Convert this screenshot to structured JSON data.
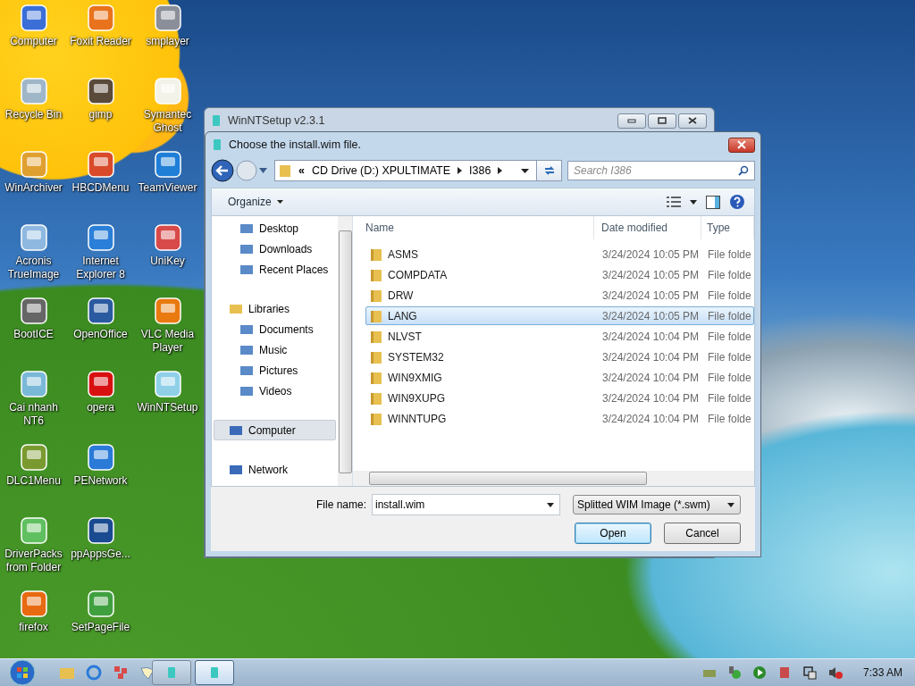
{
  "desktop": {
    "icon_rows": [
      [
        "Computer",
        "Foxit Reader",
        "smplayer"
      ],
      [
        "Recycle Bin",
        "gimp",
        "Symantec Ghost"
      ],
      [
        "WinArchiver",
        "HBCDMenu",
        "TeamViewer"
      ],
      [
        "Acronis TrueImage",
        "Internet Explorer 8",
        "UniKey"
      ],
      [
        "BootICE",
        "OpenOffice",
        "VLC Media Player"
      ],
      [
        "Cai nhanh NT6",
        "opera",
        "WinNTSetup"
      ],
      [
        "DLC1Menu",
        "PENetwork"
      ],
      [
        "DriverPacks from Folder",
        "ppAppsGe..."
      ],
      [
        "firefox",
        "SetPageFile"
      ]
    ]
  },
  "back_window": {
    "title": "WinNTSetup v2.3.1"
  },
  "dialog": {
    "title": "Choose the install.wim file.",
    "breadcrumb": [
      "«",
      "CD Drive (D:) XPULTIMATE",
      "I386"
    ],
    "search": {
      "placeholder": "Search I386"
    },
    "organize": "Organize",
    "nav": [
      {
        "children": [
          {
            "label": "Desktop",
            "selected": false
          },
          {
            "label": "Downloads",
            "selected": false
          },
          {
            "label": "Recent Places",
            "selected": false
          }
        ]
      },
      {
        "label": "Libraries",
        "selected": false,
        "children": [
          {
            "label": "Documents",
            "selected": false
          },
          {
            "label": "Music",
            "selected": false
          },
          {
            "label": "Pictures",
            "selected": false
          },
          {
            "label": "Videos",
            "selected": false
          }
        ]
      },
      {
        "label": "Computer",
        "selected": true
      },
      {
        "label": "Network",
        "selected": false
      }
    ],
    "columns": [
      "Name",
      "Date modified",
      "Type"
    ],
    "rows": [
      {
        "name": "ASMS",
        "date": "3/24/2024 10:05 PM",
        "type": "File folde",
        "selected": false
      },
      {
        "name": "COMPDATA",
        "date": "3/24/2024 10:05 PM",
        "type": "File folde",
        "selected": false
      },
      {
        "name": "DRW",
        "date": "3/24/2024 10:05 PM",
        "type": "File folde",
        "selected": false
      },
      {
        "name": "LANG",
        "date": "3/24/2024 10:05 PM",
        "type": "File folde",
        "selected": true
      },
      {
        "name": "NLVST",
        "date": "3/24/2024 10:04 PM",
        "type": "File folde",
        "selected": false
      },
      {
        "name": "SYSTEM32",
        "date": "3/24/2024 10:04 PM",
        "type": "File folde",
        "selected": false
      },
      {
        "name": "WIN9XMIG",
        "date": "3/24/2024 10:04 PM",
        "type": "File folde",
        "selected": false
      },
      {
        "name": "WIN9XUPG",
        "date": "3/24/2024 10:04 PM",
        "type": "File folde",
        "selected": false
      },
      {
        "name": "WINNTUPG",
        "date": "3/24/2024 10:04 PM",
        "type": "File folde",
        "selected": false
      }
    ],
    "file_name_label": "File name:",
    "file_name": "install.wim",
    "filter": "Splitted WIM Image (*.swm)",
    "buttons": [
      {
        "label": "Open",
        "kind": "default"
      },
      {
        "label": "Cancel",
        "kind": "normal"
      }
    ]
  },
  "taskbar": {
    "window_buttons": [
      {
        "selected": false
      },
      {
        "selected": true
      }
    ],
    "clock": "7:33 AM"
  }
}
